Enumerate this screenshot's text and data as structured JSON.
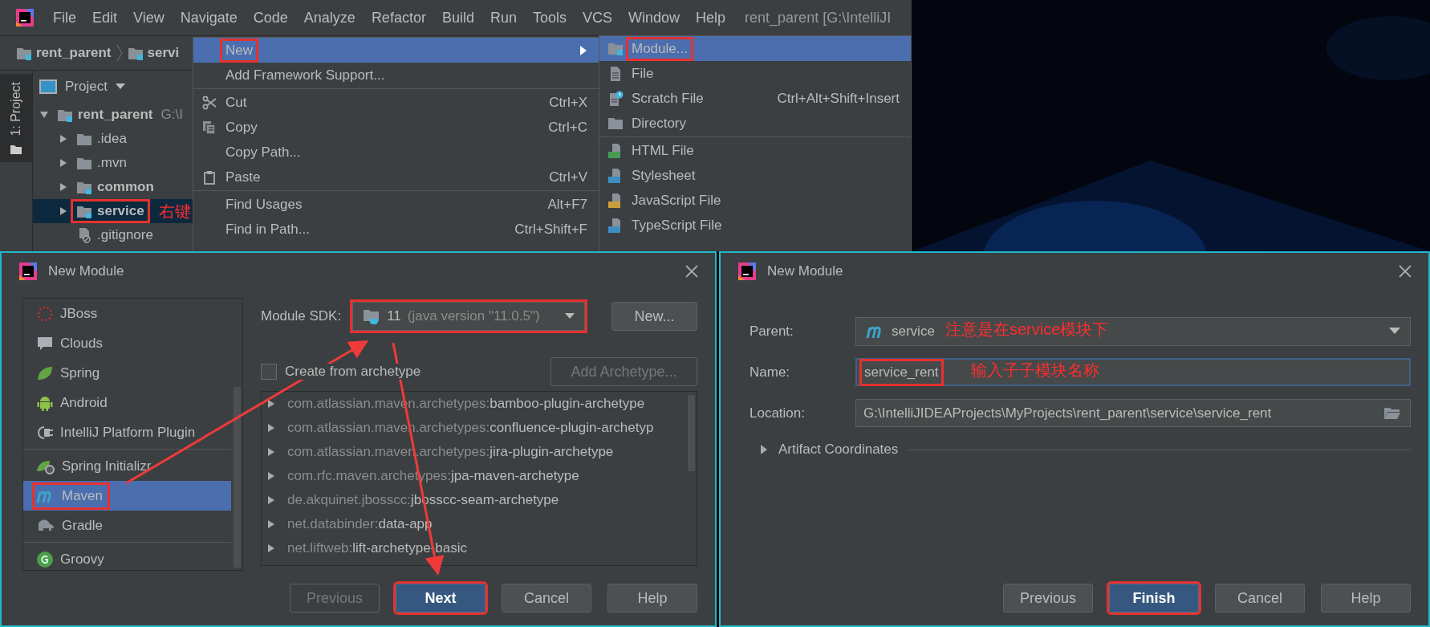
{
  "ide": {
    "menu_bar": [
      "File",
      "Edit",
      "View",
      "Navigate",
      "Code",
      "Analyze",
      "Refactor",
      "Build",
      "Run",
      "Tools",
      "VCS",
      "Window",
      "Help"
    ],
    "title": "rent_parent [G:\\IntelliJI",
    "breadcrumbs": [
      "rent_parent",
      "servi"
    ],
    "tool_window_tab": "1: Project",
    "project_panel": {
      "title": "Project",
      "tree": [
        {
          "label": "rent_parent",
          "path": "G:\\I",
          "kind": "module",
          "expanded": true,
          "selected": false,
          "marked": false,
          "children": [
            {
              "label": ".idea",
              "kind": "folder",
              "expanded": false,
              "selected": false,
              "marked": false
            },
            {
              "label": ".mvn",
              "kind": "folder",
              "expanded": false,
              "selected": false,
              "marked": false
            },
            {
              "label": "common",
              "kind": "module",
              "expanded": false,
              "selected": false,
              "marked": false
            },
            {
              "label": "service",
              "kind": "module",
              "expanded": false,
              "selected": true,
              "marked": true,
              "note": "右键"
            },
            {
              "label": ".gitignore",
              "kind": "file",
              "selected": false,
              "marked": false
            }
          ]
        }
      ]
    }
  },
  "context_menu": {
    "items": [
      {
        "kind": "submenu",
        "label": "New",
        "selected": true,
        "marked": true
      },
      {
        "kind": "plain",
        "label": "Add Framework Support...",
        "selected": false,
        "marked": false
      },
      {
        "kind": "separator"
      },
      {
        "kind": "cut",
        "label": "Cut",
        "shortcut": "Ctrl+X",
        "selected": false,
        "marked": false
      },
      {
        "kind": "copy",
        "label": "Copy",
        "shortcut": "Ctrl+C",
        "selected": false,
        "marked": false
      },
      {
        "kind": "plain",
        "label": "Copy Path...",
        "selected": false,
        "marked": false
      },
      {
        "kind": "paste",
        "label": "Paste",
        "shortcut": "Ctrl+V",
        "selected": false,
        "marked": false
      },
      {
        "kind": "separator"
      },
      {
        "kind": "plain",
        "label": "Find Usages",
        "shortcut": "Alt+F7",
        "selected": false,
        "marked": false
      },
      {
        "kind": "plain",
        "label": "Find in Path...",
        "shortcut": "Ctrl+Shift+F",
        "selected": false,
        "marked": false
      }
    ]
  },
  "submenu": {
    "items": [
      {
        "kind": "module",
        "label": "Module...",
        "selected": true,
        "marked": true
      },
      {
        "kind": "file",
        "label": "File",
        "selected": false,
        "marked": false
      },
      {
        "kind": "scratch",
        "label": "Scratch File",
        "shortcut": "Ctrl+Alt+Shift+Insert",
        "selected": false,
        "marked": false
      },
      {
        "kind": "directory",
        "label": "Directory",
        "selected": false,
        "marked": false
      },
      {
        "kind": "separator"
      },
      {
        "kind": "html",
        "label": "HTML File",
        "selected": false,
        "marked": false
      },
      {
        "kind": "css",
        "label": "Stylesheet",
        "selected": false,
        "marked": false
      },
      {
        "kind": "js",
        "label": "JavaScript File",
        "selected": false,
        "marked": false
      },
      {
        "kind": "ts",
        "label": "TypeScript File",
        "selected": false,
        "marked": false
      }
    ]
  },
  "new_module_dialog_1": {
    "title": "New Module",
    "categories": [
      {
        "kind": "jboss",
        "label": "JBoss",
        "selected": false,
        "marked": false
      },
      {
        "kind": "clouds",
        "label": "Clouds",
        "selected": false,
        "marked": false
      },
      {
        "kind": "spring",
        "label": "Spring",
        "selected": false,
        "marked": false
      },
      {
        "kind": "android",
        "label": "Android",
        "selected": false,
        "marked": false
      },
      {
        "kind": "plugin",
        "label": "IntelliJ Platform Plugin",
        "selected": false,
        "marked": false
      },
      {
        "kind": "separator"
      },
      {
        "kind": "initializr",
        "label": "Spring Initializr",
        "selected": false,
        "marked": false
      },
      {
        "kind": "maven",
        "label": "Maven",
        "selected": true,
        "marked": true
      },
      {
        "kind": "gradle",
        "label": "Gradle",
        "selected": false,
        "marked": false
      },
      {
        "kind": "separator"
      },
      {
        "kind": "groovy",
        "label": "Groovy",
        "selected": false,
        "marked": false
      }
    ],
    "sdk": {
      "label": "Module SDK:",
      "version": "11",
      "detail": "(java version \"11.0.5\")",
      "marked": true
    },
    "new_button": "New...",
    "archetype_checkbox": {
      "label": "Create from archetype",
      "checked": false
    },
    "add_archetype_button": {
      "label": "Add Archetype...",
      "disabled": true
    },
    "archetypes": [
      {
        "group": "com.atlassian.maven.archetypes:",
        "artifact": "bamboo-plugin-archetype",
        "expanded": false
      },
      {
        "group": "com.atlassian.maven.archetypes:",
        "artifact": "confluence-plugin-archetyp",
        "expanded": false
      },
      {
        "group": "com.atlassian.maven.archetypes:",
        "artifact": "jira-plugin-archetype",
        "expanded": false
      },
      {
        "group": "com.rfc.maven.archetypes:",
        "artifact": "jpa-maven-archetype",
        "expanded": false
      },
      {
        "group": "de.akquinet.jbosscc:",
        "artifact": "jbosscc-seam-archetype",
        "expanded": false
      },
      {
        "group": "net.databinder:",
        "artifact": "data-app",
        "expanded": false
      },
      {
        "group": "net.liftweb:",
        "artifact": "lift-archetype-basic",
        "expanded": false
      }
    ],
    "buttons": [
      {
        "label": "Previous",
        "disabled": true,
        "default": false,
        "marked": false
      },
      {
        "label": "Next",
        "disabled": false,
        "default": true,
        "marked": true
      },
      {
        "label": "Cancel",
        "disabled": false,
        "default": false,
        "marked": false
      },
      {
        "label": "Help",
        "disabled": false,
        "default": false,
        "marked": false
      }
    ]
  },
  "new_module_dialog_2": {
    "title": "New Module",
    "parent": {
      "label": "Parent:",
      "value": "service",
      "note": "注意是在service模块下"
    },
    "name": {
      "label": "Name:",
      "value": "service_rent",
      "note": "输入子子模块名称",
      "focused": true,
      "marked": true
    },
    "location": {
      "label": "Location:",
      "value": "G:\\IntelliJIDEAProjects\\MyProjects\\rent_parent\\service\\service_rent"
    },
    "artifact_coordinates": {
      "label": "Artifact Coordinates",
      "expanded": false
    },
    "buttons": [
      {
        "label": "Previous",
        "disabled": false,
        "default": false,
        "marked": false
      },
      {
        "label": "Finish",
        "disabled": false,
        "default": true,
        "marked": true
      },
      {
        "label": "Cancel",
        "disabled": false,
        "default": false,
        "marked": false
      },
      {
        "label": "Help",
        "disabled": false,
        "default": false,
        "marked": false
      }
    ]
  }
}
